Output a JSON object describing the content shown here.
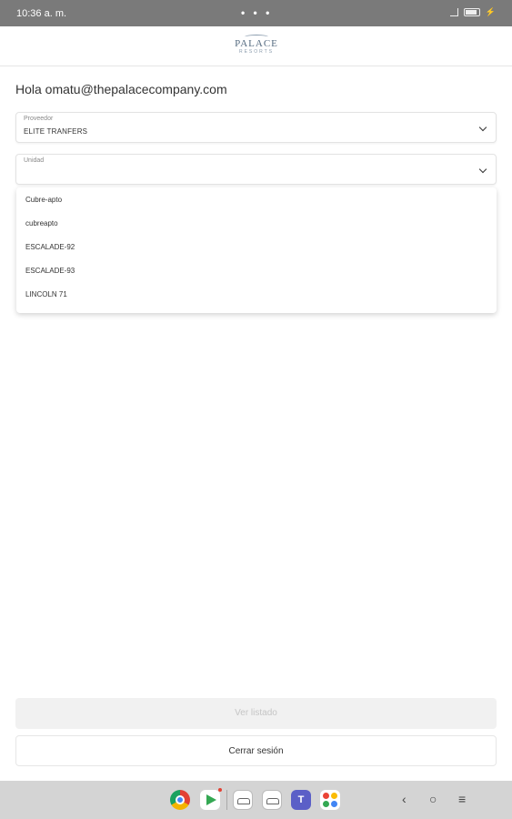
{
  "status_bar": {
    "time": "10:36 a. m.",
    "dots": "• • •"
  },
  "header": {
    "logo_main": "PALACE",
    "logo_sub": "RESORTS"
  },
  "greeting": "Hola omatu@thepalacecompany.com",
  "proveedor": {
    "label": "Proveedor",
    "value": "ELITE TRANFERS"
  },
  "unidad": {
    "label": "Unidad",
    "value": ""
  },
  "unidad_options": [
    "Cubre-apto",
    "cubreapto",
    "ESCALADE-92",
    "ESCALADE-93",
    "LINCOLN 71"
  ],
  "buttons": {
    "ver_listado": "Ver listado",
    "cerrar_sesion": "Cerrar sesión"
  },
  "dock": {
    "icons": [
      "chrome-icon",
      "play-store-icon",
      "car-app-icon",
      "car-app-icon",
      "teams-icon",
      "apps-icon"
    ]
  },
  "nav": {
    "back": "‹",
    "home": "○",
    "recents": "≡"
  },
  "colors": {
    "status_bar": "#7a7a7a",
    "nav_bar": "#d4d4d4",
    "logo": "#556b80",
    "disabled_text": "#c5c5c5"
  }
}
